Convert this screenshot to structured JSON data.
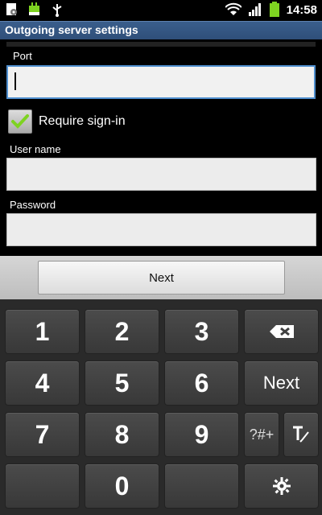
{
  "status_bar": {
    "time": "14:58",
    "left_icons": [
      "settings-notification-icon",
      "android-battery-icon",
      "usb-icon"
    ],
    "right_icons": [
      "wifi-icon",
      "signal-icon",
      "battery-icon"
    ]
  },
  "title": "Outgoing server settings",
  "form": {
    "port_label": "Port",
    "port_value": "",
    "require_signin_label": "Require sign-in",
    "require_signin_checked": true,
    "username_label": "User name",
    "username_value": "",
    "password_label": "Password",
    "password_value": ""
  },
  "next_button_label": "Next",
  "keyboard": {
    "row1": [
      "1",
      "2",
      "3"
    ],
    "row2": [
      "4",
      "5",
      "6"
    ],
    "row3": [
      "7",
      "8",
      "9"
    ],
    "row4_center": "0",
    "next_key_label": "Next",
    "symbols_key_label": "?#+",
    "colors": {
      "key": "#3f3f3f",
      "board": "#2a2a2a",
      "accent": "#4f8fcf",
      "check": "#7ed321"
    }
  }
}
